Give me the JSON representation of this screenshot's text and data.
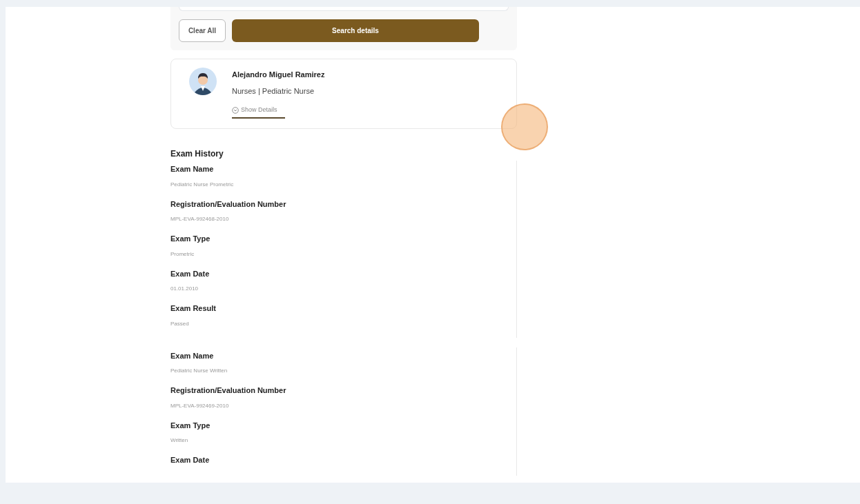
{
  "search_panel": {
    "buttons": [
      {
        "kind": "secondary",
        "label": "Clear All"
      },
      {
        "kind": "primary",
        "label": "Search details"
      }
    ]
  },
  "profile": {
    "name": "Alejandro Miguel Ramirez",
    "subtitle": "Nurses | Pediatric Nurse",
    "toggle": "Show Details"
  },
  "exam_history": {
    "title": "Exam History",
    "exams": [
      {
        "fields": [
          {
            "label": "Exam Name",
            "value": "Pediatric Nurse Prometric"
          },
          {
            "label": "Registration/Evaluation Number",
            "value": "MPL-EVA-992468-2010"
          },
          {
            "label": "Exam Type",
            "value": "Prometric"
          },
          {
            "label": "Exam Date",
            "value": "01.01.2010"
          },
          {
            "label": "Exam Result",
            "value": "Passed"
          }
        ]
      },
      {
        "fields": [
          {
            "label": "Exam Name",
            "value": "Pediatric Nurse Written"
          },
          {
            "label": "Registration/Evaluation Number",
            "value": "MPL-EVA-992469-2010"
          },
          {
            "label": "Exam Type",
            "value": "Written"
          },
          {
            "label": "Exam Date"
          }
        ]
      }
    ]
  }
}
